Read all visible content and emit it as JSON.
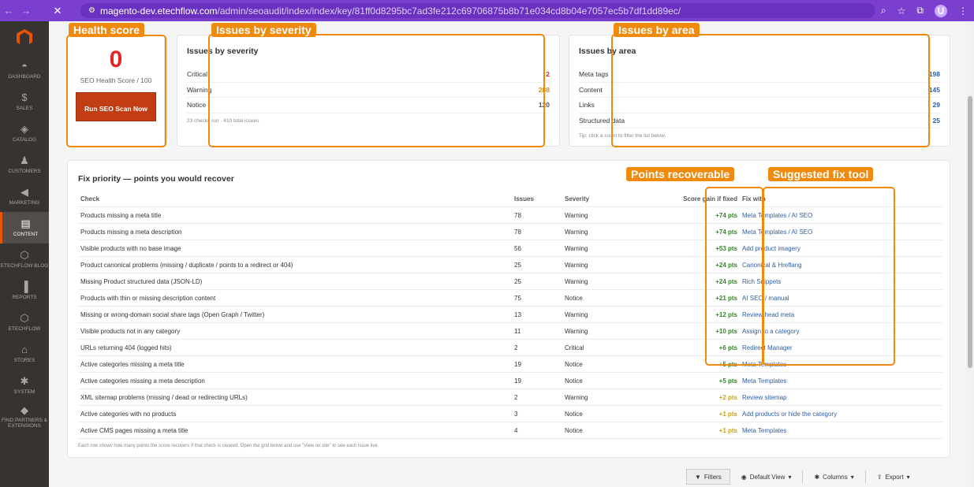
{
  "browser": {
    "url_host": "magento-dev.etechflow.com",
    "url_path": "/admin/seoaudit/index/index/key/81ff0d8295bc7ad3fe212c69706875b8b71e034cd8b04e7057ec5b7df1dd89ec/",
    "avatar": "U"
  },
  "sidebar": {
    "items": [
      {
        "label": "DASHBOARD",
        "icon": "gauge-icon"
      },
      {
        "label": "SALES",
        "icon": "dollar-icon"
      },
      {
        "label": "CATALOG",
        "icon": "cube-icon"
      },
      {
        "label": "CUSTOMERS",
        "icon": "person-icon"
      },
      {
        "label": "MARKETING",
        "icon": "megaphone-icon"
      },
      {
        "label": "CONTENT",
        "icon": "layout-icon"
      },
      {
        "label": "ETECHFLOW BLOG",
        "icon": "hexagon-icon"
      },
      {
        "label": "REPORTS",
        "icon": "bar-chart-icon"
      },
      {
        "label": "ETECHFLOW",
        "icon": "hexagon-icon"
      },
      {
        "label": "STORES",
        "icon": "store-icon"
      },
      {
        "label": "SYSTEM",
        "icon": "gear-icon"
      },
      {
        "label": "FIND PARTNERS & EXTENSIONS",
        "icon": "box-icon"
      }
    ]
  },
  "health": {
    "score": "0",
    "label": "SEO Health Score / 100",
    "button": "Run SEO Scan Now"
  },
  "severity": {
    "title": "Issues by severity",
    "rows": [
      {
        "label": "Critical",
        "value": "2",
        "color": "#e22626"
      },
      {
        "label": "Warning",
        "value": "288",
        "color": "#d48a0a"
      },
      {
        "label": "Notice",
        "value": "120",
        "color": "#555555"
      }
    ],
    "note": "23 checks run · 410 total issues"
  },
  "area": {
    "title": "Issues by area",
    "rows": [
      {
        "label": "Meta tags",
        "value": "198"
      },
      {
        "label": "Content",
        "value": "145"
      },
      {
        "label": "Links",
        "value": "29"
      },
      {
        "label": "Structured data",
        "value": "25"
      }
    ],
    "note": "Tip: click a count to filter the list below."
  },
  "fix": {
    "title": "Fix priority — points you would recover",
    "headers": {
      "check": "Check",
      "issues": "Issues",
      "severity": "Severity",
      "gain": "Score gain if fixed",
      "fix": "Fix with"
    },
    "rows": [
      {
        "check": "Products missing a meta title",
        "issues": "78",
        "severity": "Warning",
        "gain": "+74 pts",
        "fix": "Meta Templates / AI SEO"
      },
      {
        "check": "Products missing a meta description",
        "issues": "78",
        "severity": "Warning",
        "gain": "+74 pts",
        "fix": "Meta Templates / AI SEO"
      },
      {
        "check": "Visible products with no base image",
        "issues": "56",
        "severity": "Warning",
        "gain": "+53 pts",
        "fix": "Add product imagery"
      },
      {
        "check": "Product canonical problems (missing / duplicate / points to a redirect or 404)",
        "issues": "25",
        "severity": "Warning",
        "gain": "+24 pts",
        "fix": "Canonical & Hreflang"
      },
      {
        "check": "Missing Product structured data (JSON-LD)",
        "issues": "25",
        "severity": "Warning",
        "gain": "+24 pts",
        "fix": "Rich Snippets"
      },
      {
        "check": "Products with thin or missing description content",
        "issues": "75",
        "severity": "Notice",
        "gain": "+21 pts",
        "fix": "AI SEO / manual"
      },
      {
        "check": "Missing or wrong-domain social share tags (Open Graph / Twitter)",
        "issues": "13",
        "severity": "Warning",
        "gain": "+12 pts",
        "fix": "Review head meta"
      },
      {
        "check": "Visible products not in any category",
        "issues": "11",
        "severity": "Warning",
        "gain": "+10 pts",
        "fix": "Assign to a category"
      },
      {
        "check": "URLs returning 404 (logged hits)",
        "issues": "2",
        "severity": "Critical",
        "gain": "+6 pts",
        "fix": "Redirect Manager"
      },
      {
        "check": "Active categories missing a meta title",
        "issues": "19",
        "severity": "Notice",
        "gain": "+5 pts",
        "fix": "Meta Templates"
      },
      {
        "check": "Active categories missing a meta description",
        "issues": "19",
        "severity": "Notice",
        "gain": "+5 pts",
        "fix": "Meta Templates"
      },
      {
        "check": "XML sitemap problems (missing / dead or redirecting URLs)",
        "issues": "2",
        "severity": "Warning",
        "gain": "+2 pts",
        "fix": "Review sitemap"
      },
      {
        "check": "Active categories with no products",
        "issues": "3",
        "severity": "Notice",
        "gain": "+1 pts",
        "fix": "Add products or hide the category"
      },
      {
        "check": "Active CMS pages missing a meta title",
        "issues": "4",
        "severity": "Notice",
        "gain": "+1 pts",
        "fix": "Meta Templates"
      }
    ],
    "gain_colors": [
      "#2f8a22",
      "#2f8a22",
      "#2f8a22",
      "#2f8a22",
      "#2f8a22",
      "#2f8a22",
      "#2f8a22",
      "#2f8a22",
      "#2f8a22",
      "#2f8a22",
      "#2f8a22",
      "#c9a316",
      "#c9a316",
      "#c9a316"
    ],
    "footnote": "Each row shows how many points the score recovers if that check is cleared. Open the grid below and use \"View on site\" to see each issue live."
  },
  "toolbar": {
    "filters": "Filters",
    "view": "Default View",
    "columns": "Columns",
    "export": "Export"
  },
  "annotations": {
    "health": "Health score",
    "severity": "Issues by severity",
    "area": "Issues by area",
    "points": "Points recoverable",
    "fixtool": "Suggested fix tool"
  },
  "colors": {
    "accent": "#ef8a0c",
    "brand": "#eb5202",
    "link": "#2e5fa3"
  }
}
